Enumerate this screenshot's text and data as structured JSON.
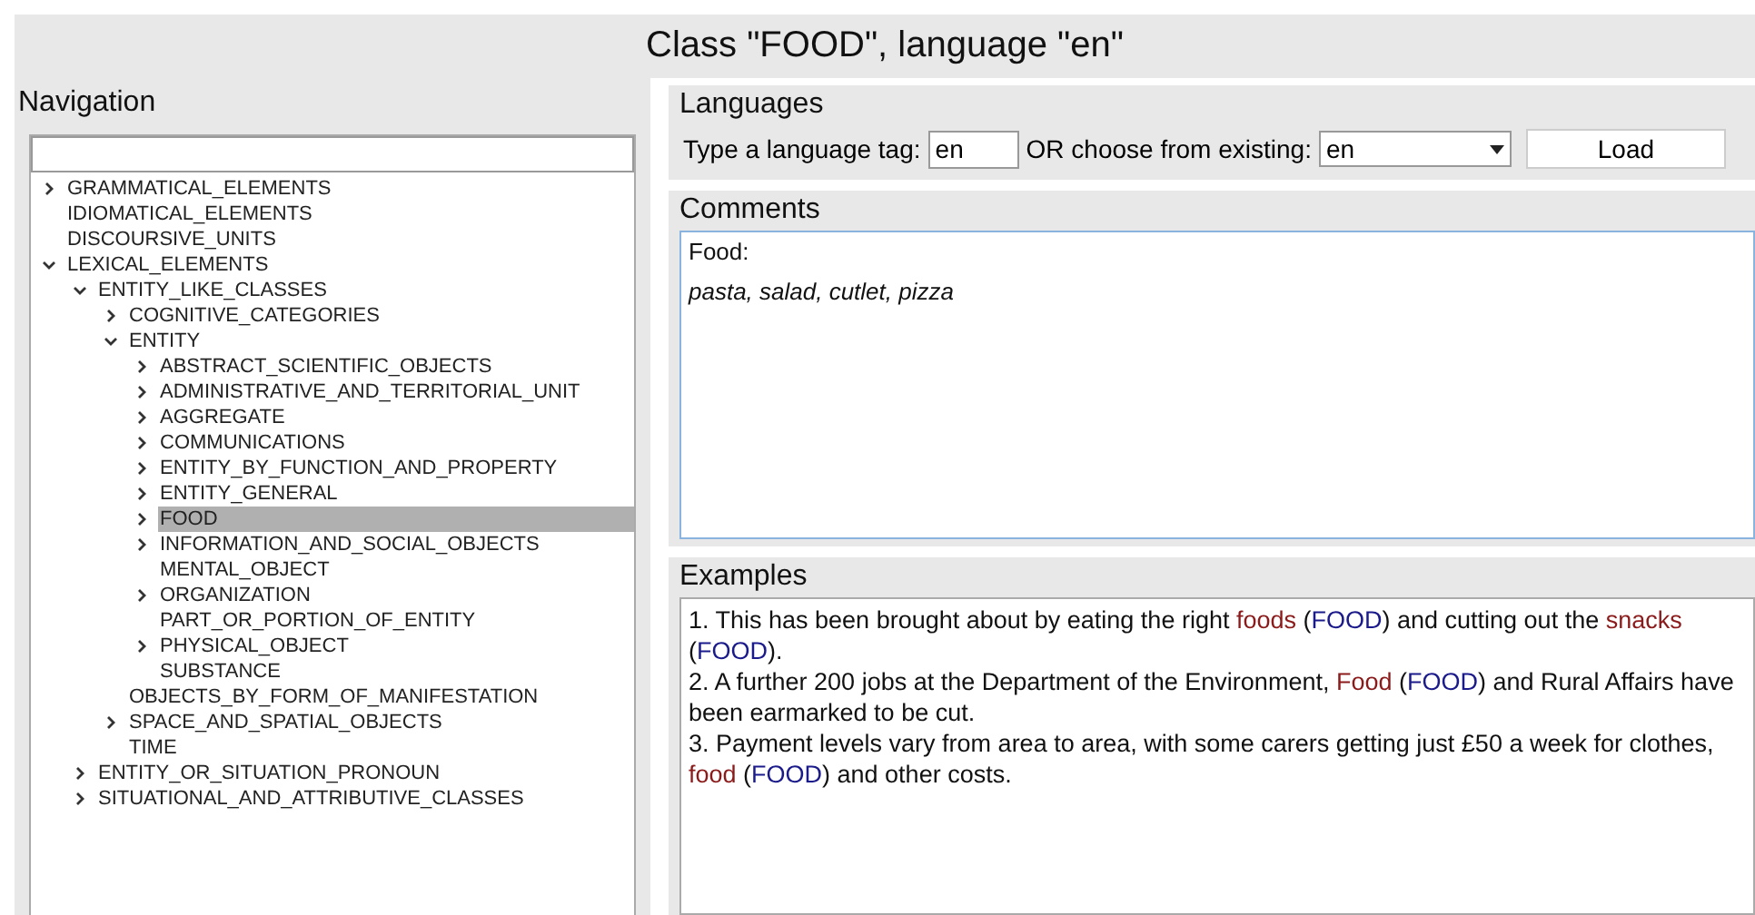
{
  "window": {
    "title": "Class \"FOOD\", language \"en\""
  },
  "navigation": {
    "title": "Navigation",
    "tree": [
      {
        "label": "GRAMMATICAL_ELEMENTS",
        "kind": "branch",
        "expanded": false,
        "selected": false
      },
      {
        "label": "IDIOMATICAL_ELEMENTS",
        "kind": "leaf",
        "selected": false
      },
      {
        "label": "DISCOURSIVE_UNITS",
        "kind": "leaf",
        "selected": false
      },
      {
        "label": "LEXICAL_ELEMENTS",
        "kind": "branch",
        "expanded": true,
        "selected": false,
        "children": [
          {
            "label": "ENTITY_LIKE_CLASSES",
            "kind": "branch",
            "expanded": true,
            "selected": false,
            "children": [
              {
                "label": "COGNITIVE_CATEGORIES",
                "kind": "branch",
                "expanded": false,
                "selected": false
              },
              {
                "label": "ENTITY",
                "kind": "branch",
                "expanded": true,
                "selected": false,
                "children": [
                  {
                    "label": "ABSTRACT_SCIENTIFIC_OBJECTS",
                    "kind": "branch",
                    "expanded": false,
                    "selected": false
                  },
                  {
                    "label": "ADMINISTRATIVE_AND_TERRITORIAL_UNIT",
                    "kind": "branch",
                    "expanded": false,
                    "selected": false
                  },
                  {
                    "label": "AGGREGATE",
                    "kind": "branch",
                    "expanded": false,
                    "selected": false
                  },
                  {
                    "label": "COMMUNICATIONS",
                    "kind": "branch",
                    "expanded": false,
                    "selected": false
                  },
                  {
                    "label": "ENTITY_BY_FUNCTION_AND_PROPERTY",
                    "kind": "branch",
                    "expanded": false,
                    "selected": false
                  },
                  {
                    "label": "ENTITY_GENERAL",
                    "kind": "branch",
                    "expanded": false,
                    "selected": false
                  },
                  {
                    "label": "FOOD",
                    "kind": "branch",
                    "expanded": false,
                    "selected": true
                  },
                  {
                    "label": "INFORMATION_AND_SOCIAL_OBJECTS",
                    "kind": "branch",
                    "expanded": false,
                    "selected": false
                  },
                  {
                    "label": "MENTAL_OBJECT",
                    "kind": "leaf",
                    "selected": false
                  },
                  {
                    "label": "ORGANIZATION",
                    "kind": "branch",
                    "expanded": false,
                    "selected": false
                  },
                  {
                    "label": "PART_OR_PORTION_OF_ENTITY",
                    "kind": "leaf",
                    "selected": false
                  },
                  {
                    "label": "PHYSICAL_OBJECT",
                    "kind": "branch",
                    "expanded": false,
                    "selected": false
                  },
                  {
                    "label": "SUBSTANCE",
                    "kind": "leaf",
                    "selected": false
                  }
                ]
              },
              {
                "label": "OBJECTS_BY_FORM_OF_MANIFESTATION",
                "kind": "leaf",
                "selected": false
              },
              {
                "label": "SPACE_AND_SPATIAL_OBJECTS",
                "kind": "branch",
                "expanded": false,
                "selected": false
              },
              {
                "label": "TIME",
                "kind": "leaf",
                "selected": false
              }
            ]
          },
          {
            "label": "ENTITY_OR_SITUATION_PRONOUN",
            "kind": "branch",
            "expanded": false,
            "selected": false
          },
          {
            "label": "SITUATIONAL_AND_ATTRIBUTIVE_CLASSES",
            "kind": "branch",
            "expanded": false,
            "selected": false
          }
        ]
      }
    ]
  },
  "languages": {
    "title": "Languages",
    "tag_label": "Type a language tag:",
    "tag_value": "en",
    "choose_label": "OR choose from existing:",
    "choose_value": "en",
    "button": "Load"
  },
  "comments": {
    "title": "Comments",
    "lines": [
      {
        "text": "Food:",
        "kind": "plain"
      },
      {
        "text": "pasta, salad, cutlet, pizza",
        "kind": "italic"
      }
    ]
  },
  "examples": {
    "title": "Examples",
    "items": [
      [
        {
          "kind": "plain",
          "text": "1. This has been brought about by eating the right "
        },
        {
          "kind": "word",
          "text": "foods"
        },
        {
          "kind": "plain",
          "text": " ("
        },
        {
          "kind": "class",
          "text": "FOOD"
        },
        {
          "kind": "plain",
          "text": ") and cutting out the "
        },
        {
          "kind": "word",
          "text": "snacks"
        },
        {
          "kind": "plain",
          "text": " ("
        },
        {
          "kind": "class",
          "text": "FOOD"
        },
        {
          "kind": "plain",
          "text": ")."
        }
      ],
      [
        {
          "kind": "plain",
          "text": "2. A further 200 jobs at the Department of the Environment, "
        },
        {
          "kind": "word",
          "text": "Food"
        },
        {
          "kind": "plain",
          "text": " ("
        },
        {
          "kind": "class",
          "text": "FOOD"
        },
        {
          "kind": "plain",
          "text": ") and Rural Affairs have been earmarked to be cut."
        }
      ],
      [
        {
          "kind": "plain",
          "text": "3. Payment levels vary from area to area, with some carers getting just £50 a week for clothes, "
        },
        {
          "kind": "word",
          "text": "food"
        },
        {
          "kind": "plain",
          "text": " ("
        },
        {
          "kind": "class",
          "text": "FOOD"
        },
        {
          "kind": "plain",
          "text": ") and other costs."
        }
      ]
    ]
  }
}
